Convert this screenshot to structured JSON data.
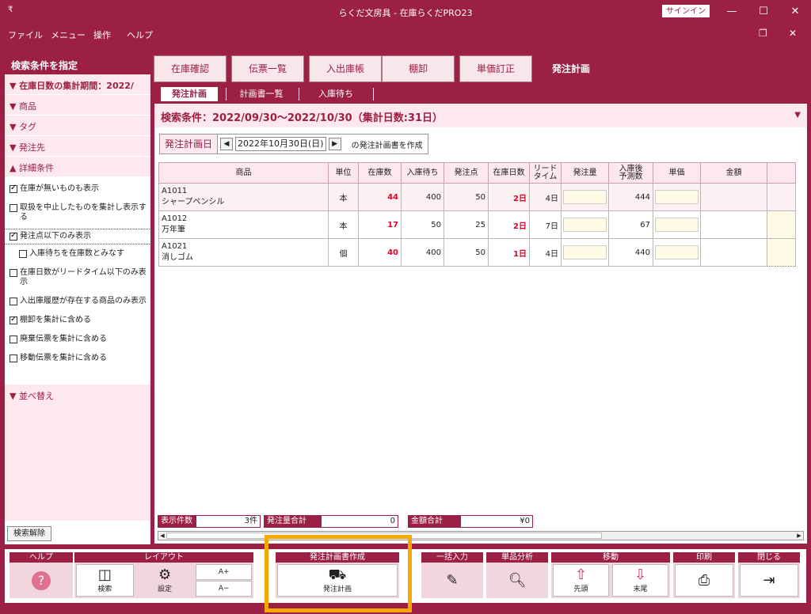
{
  "window": {
    "title": "らくだ文房具 - 在庫らくだPRO23",
    "signin": "サインイン",
    "app_icon": "₹",
    "min": "—",
    "max": "☐",
    "close": "✕",
    "restore": "❐"
  },
  "menu": [
    "ファイル",
    "メニュー",
    "操作",
    "ヘルプ"
  ],
  "left": {
    "header": "検索条件を指定",
    "sections": [
      "▼ 在庫日数の集計期間：2022/",
      "▼ 商品",
      "▼ タグ",
      "▼ 発注先",
      "▲ 詳細条件"
    ],
    "options": [
      {
        "label": "在庫が無いものも表示",
        "checked": true
      },
      {
        "label": "取扱を中止したものを集計し表示する",
        "checked": false
      },
      {
        "label": "発注点以下のみ表示",
        "checked": true
      },
      {
        "label": "入庫待ちを在庫数とみなす",
        "checked": false
      },
      {
        "label": "在庫日数がリードタイム以下のみ表示",
        "checked": false
      },
      {
        "label": "入出庫履歴が存在する商品のみ表示",
        "checked": false
      },
      {
        "label": "棚卸を集計に含める",
        "checked": true
      },
      {
        "label": "廃棄伝票を集計に含める",
        "checked": false
      },
      {
        "label": "移動伝票を集計に含める",
        "checked": false
      }
    ],
    "sort": "▼ 並べ替え",
    "clear": "検索解除"
  },
  "tabs": [
    "在庫確認",
    "伝票一覧",
    "入出庫帳",
    "棚卸",
    "単価訂正",
    "発注計画"
  ],
  "subtabs": [
    "発注計画",
    "計画書一覧",
    "入庫待ち"
  ],
  "condition": "検索条件：2022/09/30〜2022/10/30（集計日数:31日）",
  "date": {
    "label": "発注計画日",
    "value": "2022年10月30日(日)",
    "suffix": "の発注計画書を作成",
    "prev": "◀",
    "next": "▶"
  },
  "columns": [
    "商品",
    "単位",
    "在庫数",
    "入庫待ち",
    "発注点",
    "在庫日数",
    "リード\nタイム",
    "発注量",
    "入庫後\n予測数",
    "単価",
    "金額"
  ],
  "rows": [
    {
      "code": "A1011",
      "name": "シャープペンシル",
      "unit": "本",
      "stock": "44",
      "waiting": "400",
      "point": "50",
      "days": "2日",
      "lead": "4日",
      "forecast": "444"
    },
    {
      "code": "A1012",
      "name": "万年筆",
      "unit": "本",
      "stock": "17",
      "waiting": "50",
      "point": "25",
      "days": "2日",
      "lead": "7日",
      "forecast": "67"
    },
    {
      "code": "A1021",
      "name": "消しゴム",
      "unit": "個",
      "stock": "40",
      "waiting": "400",
      "point": "50",
      "days": "1日",
      "lead": "4日",
      "forecast": "440"
    }
  ],
  "summary": {
    "count_label": "表示件数",
    "count": "3件",
    "qty_label": "発注量合計",
    "qty": "0",
    "amount_label": "金額合計",
    "amount": "¥0"
  },
  "toolbar": {
    "help": "ヘルプ",
    "layout": "レイアウト",
    "search": "検索",
    "settings": "設定",
    "font_up": "A+",
    "font_down": "A−",
    "create": "発注計画書作成",
    "plan": "発注計画",
    "bulk": "一括入力",
    "analysis": "単品分析",
    "move": "移動",
    "first": "先頭",
    "last": "末尾",
    "print": "印刷",
    "close": "閉じる"
  }
}
